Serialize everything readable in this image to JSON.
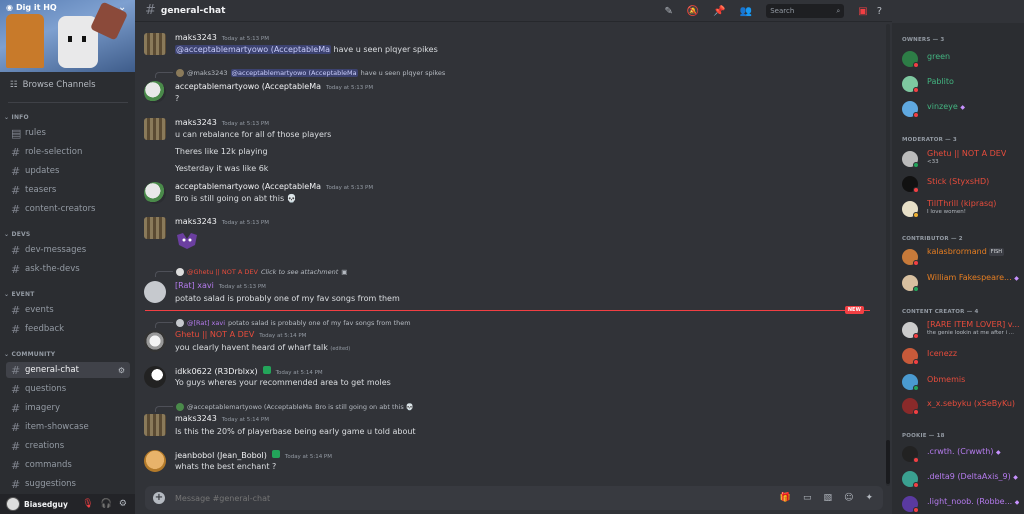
{
  "server": {
    "name": "Dig it HQ",
    "browse_label": "Browse Channels"
  },
  "sidebar": {
    "categories": [
      {
        "name": "INFO",
        "channels": [
          "rules",
          "role-selection",
          "updates",
          "teasers",
          "content-creators"
        ]
      },
      {
        "name": "DEVS",
        "channels": [
          "dev-messages",
          "ask-the-devs"
        ]
      },
      {
        "name": "EVENT",
        "channels": [
          "events",
          "feedback"
        ]
      },
      {
        "name": "COMMUNITY",
        "channels": [
          "general-chat",
          "questions",
          "imagery",
          "item-showcase",
          "creations",
          "commands",
          "suggestions"
        ]
      }
    ]
  },
  "user": {
    "name": "Biasedguy"
  },
  "header": {
    "channel": "general-chat",
    "search_placeholder": "Search"
  },
  "messages": [
    {
      "author": "maks3243",
      "time": "Today at 5:13 PM",
      "mention": "@acceptablemartyowo (AcceptableMa",
      "text": " have u seen plqyer spikes"
    },
    {
      "reply_author": "@maks3243",
      "reply_mention": "@acceptablemartyowo (AcceptableMa",
      "reply_text": " have u seen plqyer spikes",
      "author": "acceptablemartyowo (AcceptableMa",
      "time": "Today at 5:13 PM",
      "text": "?"
    },
    {
      "author": "maks3243",
      "time": "Today at 5:13 PM",
      "lines": [
        "u can rebalance for all of those players",
        "Theres like 12k playing",
        "Yesterday it was like 6k"
      ]
    },
    {
      "author": "acceptablemartyowo (AcceptableMa",
      "time": "Today at 5:13 PM",
      "text": "Bro is still going on abt this 💀"
    },
    {
      "author": "maks3243",
      "time": "Today at 5:13 PM"
    },
    {
      "reply_author": "@Ghetu || NOT A DEV",
      "reply_text": "Click to see attachment",
      "author": "[Rat] xavi",
      "time": "Today at 5:13 PM",
      "text": "potato salad is probably one of my fav songs from them"
    },
    {
      "new_label": "NEW"
    },
    {
      "reply_author": "@[Rat] xavi",
      "reply_text": " potato salad is probably one of my fav songs from them",
      "author": "Ghetu || NOT A DEV",
      "time": "Today at 5:14 PM",
      "text": "you clearly havent heard of wharf talk",
      "edited": "(edited)"
    },
    {
      "author": "idkk0622 (R3Drblxx)",
      "time": "Today at 5:14 PM",
      "text": "Yo guys wheres your recommended area to get moles"
    },
    {
      "reply_author": "@acceptablemartyowo (AcceptableMa",
      "reply_text": " Bro is still going on abt this 💀",
      "author": "maks3243",
      "time": "Today at 5:14 PM",
      "text": "Is this the 20% of playerbase being early game u told about"
    },
    {
      "author": "jeanbobol (Jean_Bobol)",
      "time": "Today at 5:14 PM",
      "text": "whats the best enchant ?"
    }
  ],
  "composer": {
    "placeholder": "Message #general-chat"
  },
  "members": {
    "owners": {
      "header": "OWNERS — 3",
      "list": [
        {
          "name": "green"
        },
        {
          "name": "Pablito"
        },
        {
          "name": "vinzeye"
        }
      ]
    },
    "moderator": {
      "header": "MODERATOR — 3",
      "list": [
        {
          "name": "Ghetu || NOT A DEV",
          "sub": "<33"
        },
        {
          "name": "Stick (StyxsHD)"
        },
        {
          "name": "TillThrill (kiprasq)",
          "sub": "I love women!"
        }
      ]
    },
    "contributor": {
      "header": "CONTRIBUTOR — 2",
      "list": [
        {
          "name": "kalasbrormand",
          "tag": "FISH"
        },
        {
          "name": "William Fakespeare..."
        }
      ]
    },
    "content_creator": {
      "header": "CONTENT CREATOR — 4",
      "list": [
        {
          "name": "[RARE ITEM LOVER] v...",
          "sub": "the genie lookin at me after i ..."
        },
        {
          "name": "Icenezz"
        },
        {
          "name": "Obmemis"
        },
        {
          "name": "x_x.sebyku (xSeByKu)"
        }
      ]
    },
    "pookie": {
      "header": "POOKIE — 18",
      "list": [
        {
          "name": ".crwth. (Crwwth)"
        },
        {
          "name": ".delta9 (DeltaAxis_9)"
        },
        {
          "name": ".light_noob. (Robbe..."
        }
      ]
    }
  },
  "colors": {
    "accent": "#5865f2",
    "dnd": "#f23f43",
    "online": "#23a55a",
    "sidebar": "#2b2d31",
    "chat": "#313338"
  }
}
